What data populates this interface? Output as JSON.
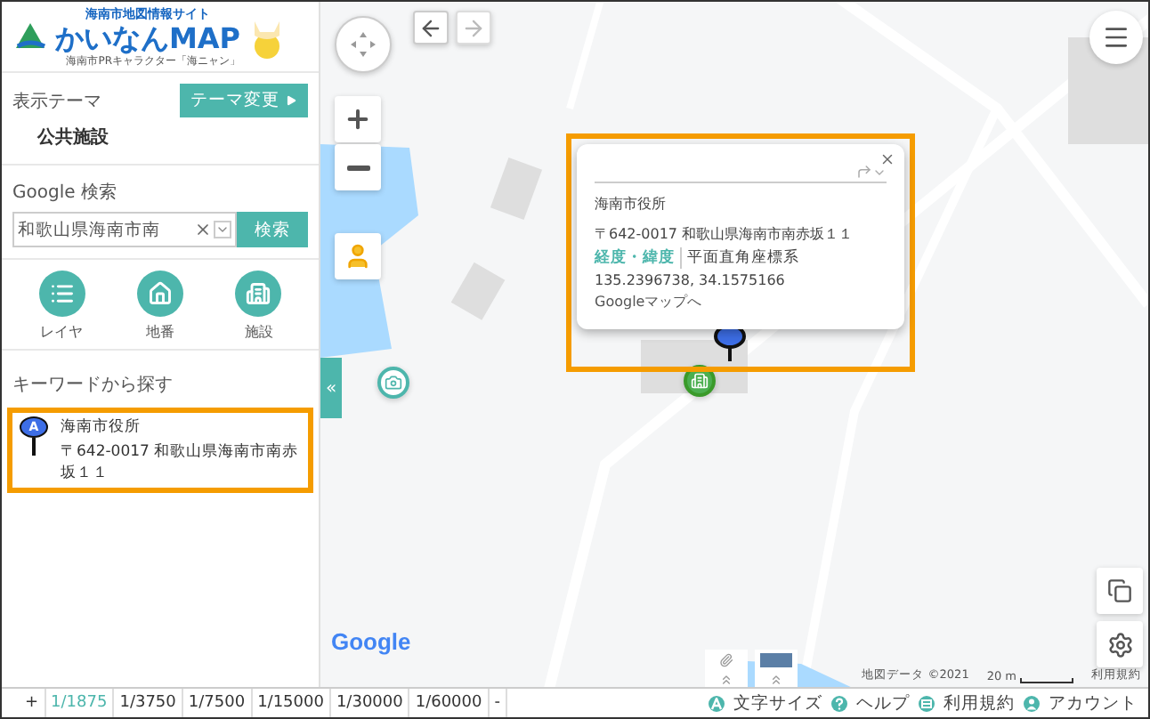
{
  "logo": {
    "tagline": "海南市地図情報サイト",
    "title": "かいなんMAP",
    "caption": "海南市PRキャラクター「海ニャン」"
  },
  "theme": {
    "label": "表示テーマ",
    "button": "テーマ変更",
    "value": "公共施設"
  },
  "google_search": {
    "label": "Google 検索",
    "value": "和歌山県海南市南",
    "button": "検索"
  },
  "tools": [
    {
      "kind": "list",
      "label": "レイヤ"
    },
    {
      "kind": "house",
      "label": "地番"
    },
    {
      "kind": "building",
      "label": "施設"
    }
  ],
  "keyword": {
    "label": "キーワードから探す"
  },
  "results": [
    {
      "marker": "A",
      "name": "海南市役所",
      "address": "〒642-0017 和歌山県海南市南赤坂１１",
      "highlighted": true
    }
  ],
  "popup": {
    "title": "海南市役所",
    "address": "〒642-0017 和歌山県海南市南赤坂１１",
    "tabs": [
      {
        "label": "経度・緯度",
        "selected": true
      },
      {
        "label": "平面直角座標系",
        "selected": false
      }
    ],
    "coordinates": "135.2396738, 34.1575166",
    "link": "Googleマップへ",
    "highlighted": true
  },
  "collapse_tab": "«",
  "map": {
    "logo": "Google",
    "attribution": "地図データ ©2021",
    "scale": "20 m",
    "terms": "利用規約"
  },
  "zoom_scales": {
    "zoom_in": "+",
    "items": [
      {
        "label": "1/1875",
        "selected": true
      },
      {
        "label": "1/3750",
        "selected": false
      },
      {
        "label": "1/7500",
        "selected": false
      },
      {
        "label": "1/15000",
        "selected": false
      },
      {
        "label": "1/30000",
        "selected": false
      },
      {
        "label": "1/60000",
        "selected": false
      }
    ],
    "zoom_out": "-"
  },
  "footer_links": [
    {
      "kind": "font",
      "label": "文字サイズ"
    },
    {
      "kind": "help",
      "label": "ヘルプ"
    },
    {
      "kind": "terms",
      "label": "利用規約"
    },
    {
      "kind": "account",
      "label": "アカウント"
    }
  ]
}
